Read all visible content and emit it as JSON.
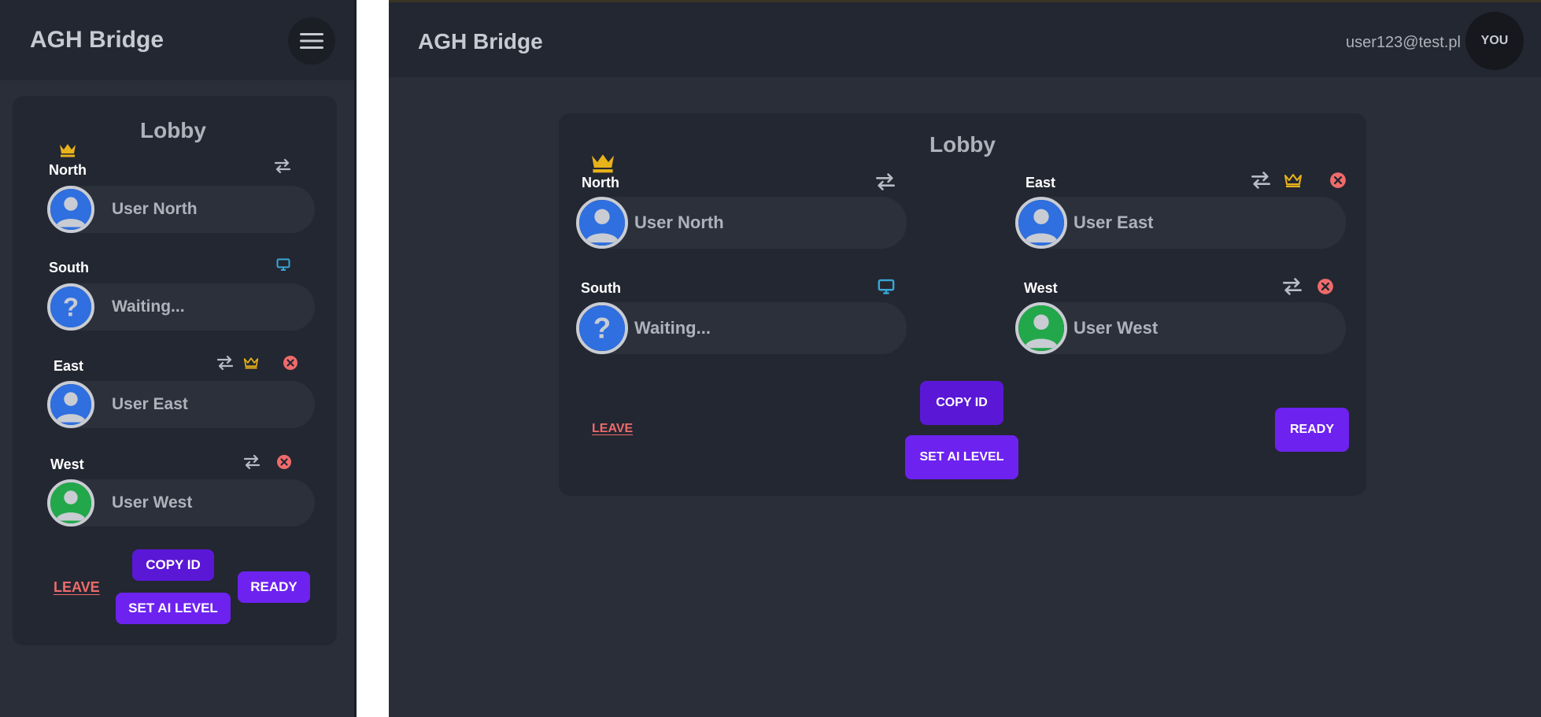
{
  "app": {
    "title": "AGH Bridge"
  },
  "header": {
    "user_email": "user123@test.pl",
    "avatar_label": "YOU"
  },
  "lobby": {
    "title": "Lobby",
    "seats": {
      "north": {
        "label": "North",
        "player": "User North",
        "status": "occupied",
        "owner": true
      },
      "south": {
        "label": "South",
        "player": "Waiting...",
        "status": "waiting",
        "ai": true
      },
      "east": {
        "label": "East",
        "player": "User East",
        "status": "occupied"
      },
      "west": {
        "label": "West",
        "player": "User West",
        "status": "occupied"
      }
    },
    "actions": {
      "leave": "LEAVE",
      "copy_id": "COPY ID",
      "set_ai": "SET AI LEVEL",
      "ready": "READY"
    }
  },
  "colors": {
    "accent": "#6d22f0",
    "accent_dark": "#5a18d6",
    "danger": "#ef6b6b",
    "crown": "#e8b21a",
    "ai_icon": "#38a7d6",
    "avatar_blue": "#2f6fe0",
    "avatar_green": "#22a84a"
  },
  "icons": [
    "menu-icon",
    "crown-icon",
    "swap-icon",
    "computer-icon",
    "close-circle-icon",
    "user-avatar-icon",
    "question-avatar-icon"
  ]
}
